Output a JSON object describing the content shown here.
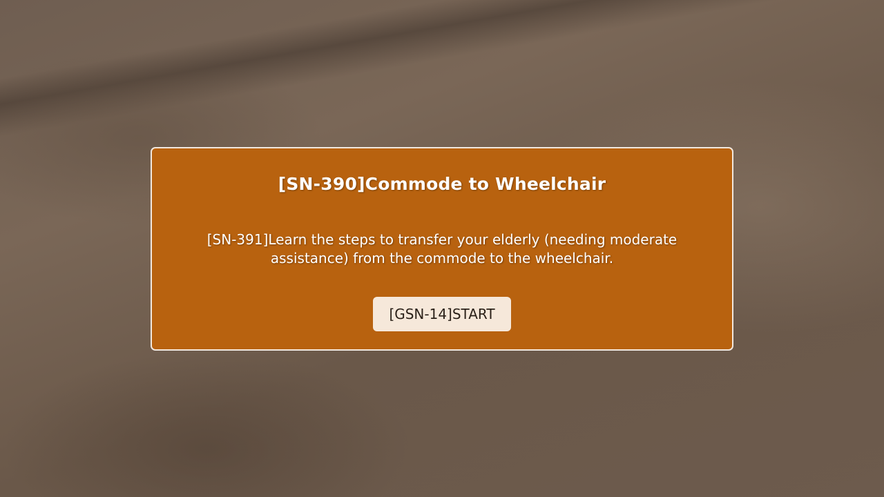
{
  "dialog": {
    "title": "[SN-390]Commode to Wheelchair",
    "description": "[SN-391]Learn the steps to transfer your elderly (needing moderate assistance) from the commode to the wheelchair.",
    "start_label": "[GSN-14]START"
  },
  "colors": {
    "dialog_background": "#b8620f",
    "dialog_border": "#f2e8de",
    "button_background": "#f6e8da",
    "button_text": "#2b2119"
  }
}
